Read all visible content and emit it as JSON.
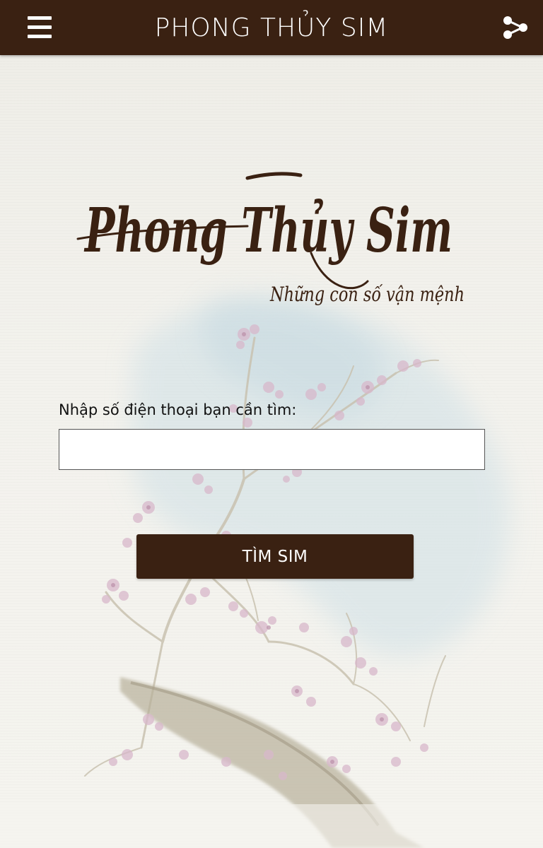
{
  "appbar": {
    "title": "PHONG THỦY SIM",
    "menu_icon": "hamburger-menu-icon",
    "share_icon": "share-icon",
    "background_color": "#3a2112"
  },
  "logo": {
    "title": "Phong Thủy Sim",
    "tagline": "Những con số vận mệnh",
    "color": "#3a2112"
  },
  "form": {
    "label": "Nhập số điện thoại bạn cần tìm:",
    "phone_value": "",
    "search_button_label": "TÌM SIM"
  }
}
